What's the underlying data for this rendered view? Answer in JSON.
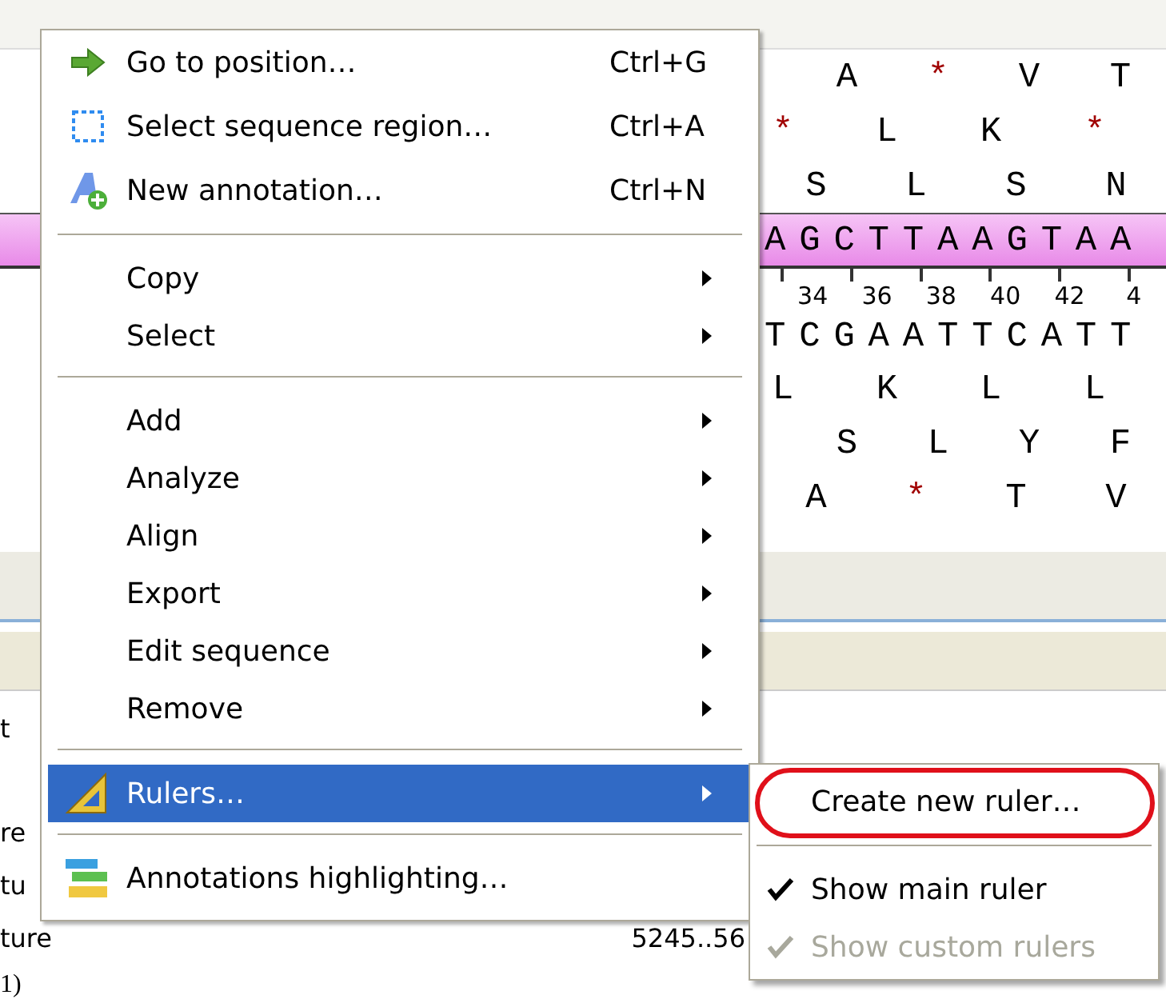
{
  "sequence_view": {
    "top_rows": [
      {
        "residues": [
          {
            "aa": "A",
            "stop": false
          },
          {
            "aa": "*",
            "stop": true
          },
          {
            "aa": "V",
            "stop": false
          },
          {
            "aa": "T",
            "stop": false
          }
        ]
      },
      {
        "residues": [
          {
            "aa": "*",
            "stop": true
          },
          {
            "aa": "L",
            "stop": false
          },
          {
            "aa": "K",
            "stop": false
          },
          {
            "aa": "*",
            "stop": true
          }
        ]
      },
      {
        "residues": [
          {
            "aa": "S",
            "stop": false
          },
          {
            "aa": "L",
            "stop": false
          },
          {
            "aa": "S",
            "stop": false
          },
          {
            "aa": "N",
            "stop": false
          }
        ]
      }
    ],
    "forward_strand": "AGCTTAAGTAA",
    "ruler_numbers": [
      "34",
      "36",
      "38",
      "40",
      "42",
      "4"
    ],
    "reverse_strand": "TCGAATTCATT",
    "bottom_rows": [
      {
        "residues": [
          {
            "aa": "L",
            "stop": false
          },
          {
            "aa": "K",
            "stop": false
          },
          {
            "aa": "L",
            "stop": false
          },
          {
            "aa": "L",
            "stop": false
          }
        ]
      },
      {
        "residues": [
          {
            "aa": "S",
            "stop": false
          },
          {
            "aa": "L",
            "stop": false
          },
          {
            "aa": "Y",
            "stop": false
          },
          {
            "aa": "F",
            "stop": false
          }
        ]
      },
      {
        "residues": [
          {
            "aa": "A",
            "stop": false
          },
          {
            "aa": "*",
            "stop": true
          },
          {
            "aa": "T",
            "stop": false
          },
          {
            "aa": "V",
            "stop": false
          }
        ]
      }
    ]
  },
  "annotation_list": {
    "fragments": [
      "t",
      "re",
      "tu"
    ],
    "last_row": {
      "name": "ture",
      "location": "5245..56"
    },
    "note": "1)"
  },
  "context_menu": {
    "groups": [
      [
        {
          "label": "Go to position…",
          "shortcut": "Ctrl+G",
          "kind": "arrow",
          "submenu": false,
          "selected": false
        },
        {
          "label": "Select sequence region…",
          "shortcut": "Ctrl+A",
          "kind": "region",
          "submenu": false,
          "selected": false
        },
        {
          "label": "New annotation…",
          "shortcut": "Ctrl+N",
          "kind": "annotation",
          "submenu": false,
          "selected": false
        }
      ],
      [
        {
          "label": "Copy",
          "submenu": true,
          "selected": false
        },
        {
          "label": "Select",
          "submenu": true,
          "selected": false
        }
      ],
      [
        {
          "label": "Add",
          "submenu": true,
          "selected": false
        },
        {
          "label": "Analyze",
          "submenu": true,
          "selected": false
        },
        {
          "label": "Align",
          "submenu": true,
          "selected": false
        },
        {
          "label": "Export",
          "submenu": true,
          "selected": false
        },
        {
          "label": "Edit sequence",
          "submenu": true,
          "selected": false
        },
        {
          "label": "Remove",
          "submenu": true,
          "selected": false
        }
      ],
      [
        {
          "label": "Rulers…",
          "kind": "ruler",
          "submenu": true,
          "selected": true
        }
      ],
      [
        {
          "label": "Annotations highlighting…",
          "kind": "layers",
          "submenu": false,
          "selected": false
        }
      ]
    ]
  },
  "submenu": {
    "groups": [
      [
        {
          "label": "Create new ruler…",
          "checked": false,
          "disabled": false,
          "circled": true
        }
      ],
      [
        {
          "label": "Show main ruler",
          "checked": true,
          "disabled": false,
          "circled": false
        },
        {
          "label": "Show custom rulers",
          "checked": true,
          "disabled": true,
          "circled": false
        }
      ]
    ]
  }
}
